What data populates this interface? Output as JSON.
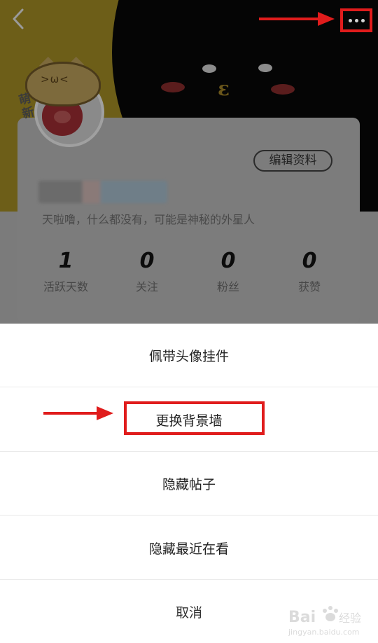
{
  "profile": {
    "edit_label": "编辑资料",
    "bio": "天啦噜，什么都没有，可能是神秘的外星人",
    "badge": "萌新",
    "stats": [
      {
        "value": "1",
        "label": "活跃天数"
      },
      {
        "value": "0",
        "label": "关注"
      },
      {
        "value": "0",
        "label": "粉丝"
      },
      {
        "value": "0",
        "label": "获赞"
      }
    ]
  },
  "sheet": {
    "items": [
      {
        "label": "佩带头像挂件"
      },
      {
        "label": "更换背景墙"
      },
      {
        "label": "隐藏帖子"
      },
      {
        "label": "隐藏最近在看"
      }
    ],
    "cancel_label": "取消"
  },
  "icons": {
    "back": "chevron-left-icon",
    "more": "more-dots-icon",
    "arrow": "red-arrow-icon"
  },
  "colors": {
    "annotation_red": "#e01c1c",
    "overlay_dim": "rgba(0,0,0,0.5)",
    "sheet_bg": "#ffffff"
  },
  "watermark": {
    "brand": "Bai",
    "brand_suffix": "经验",
    "url": "jingyan.baidu.com"
  }
}
